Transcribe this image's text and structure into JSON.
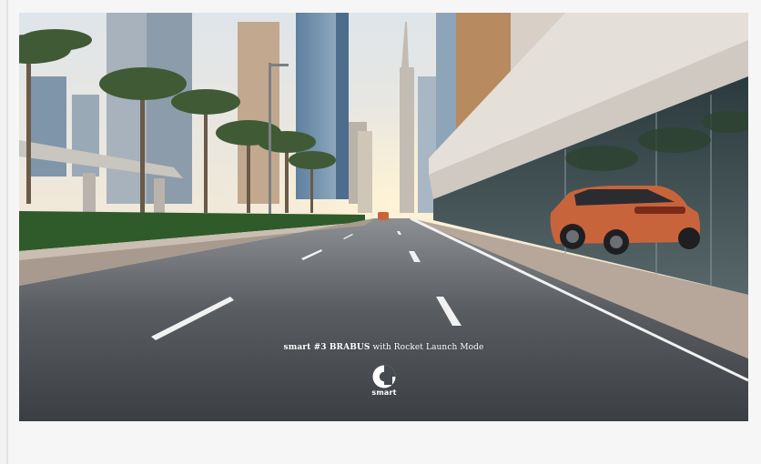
{
  "ad": {
    "caption_model": "smart #3 BRABUS",
    "caption_tagline": "with Rocket Launch Mode",
    "logo_text": "smart",
    "logo_icon": "smart-logo-icon"
  },
  "colors": {
    "page_background": "#f2f2f2",
    "text_on_image": "#ffffff",
    "car": "#c8643c"
  }
}
